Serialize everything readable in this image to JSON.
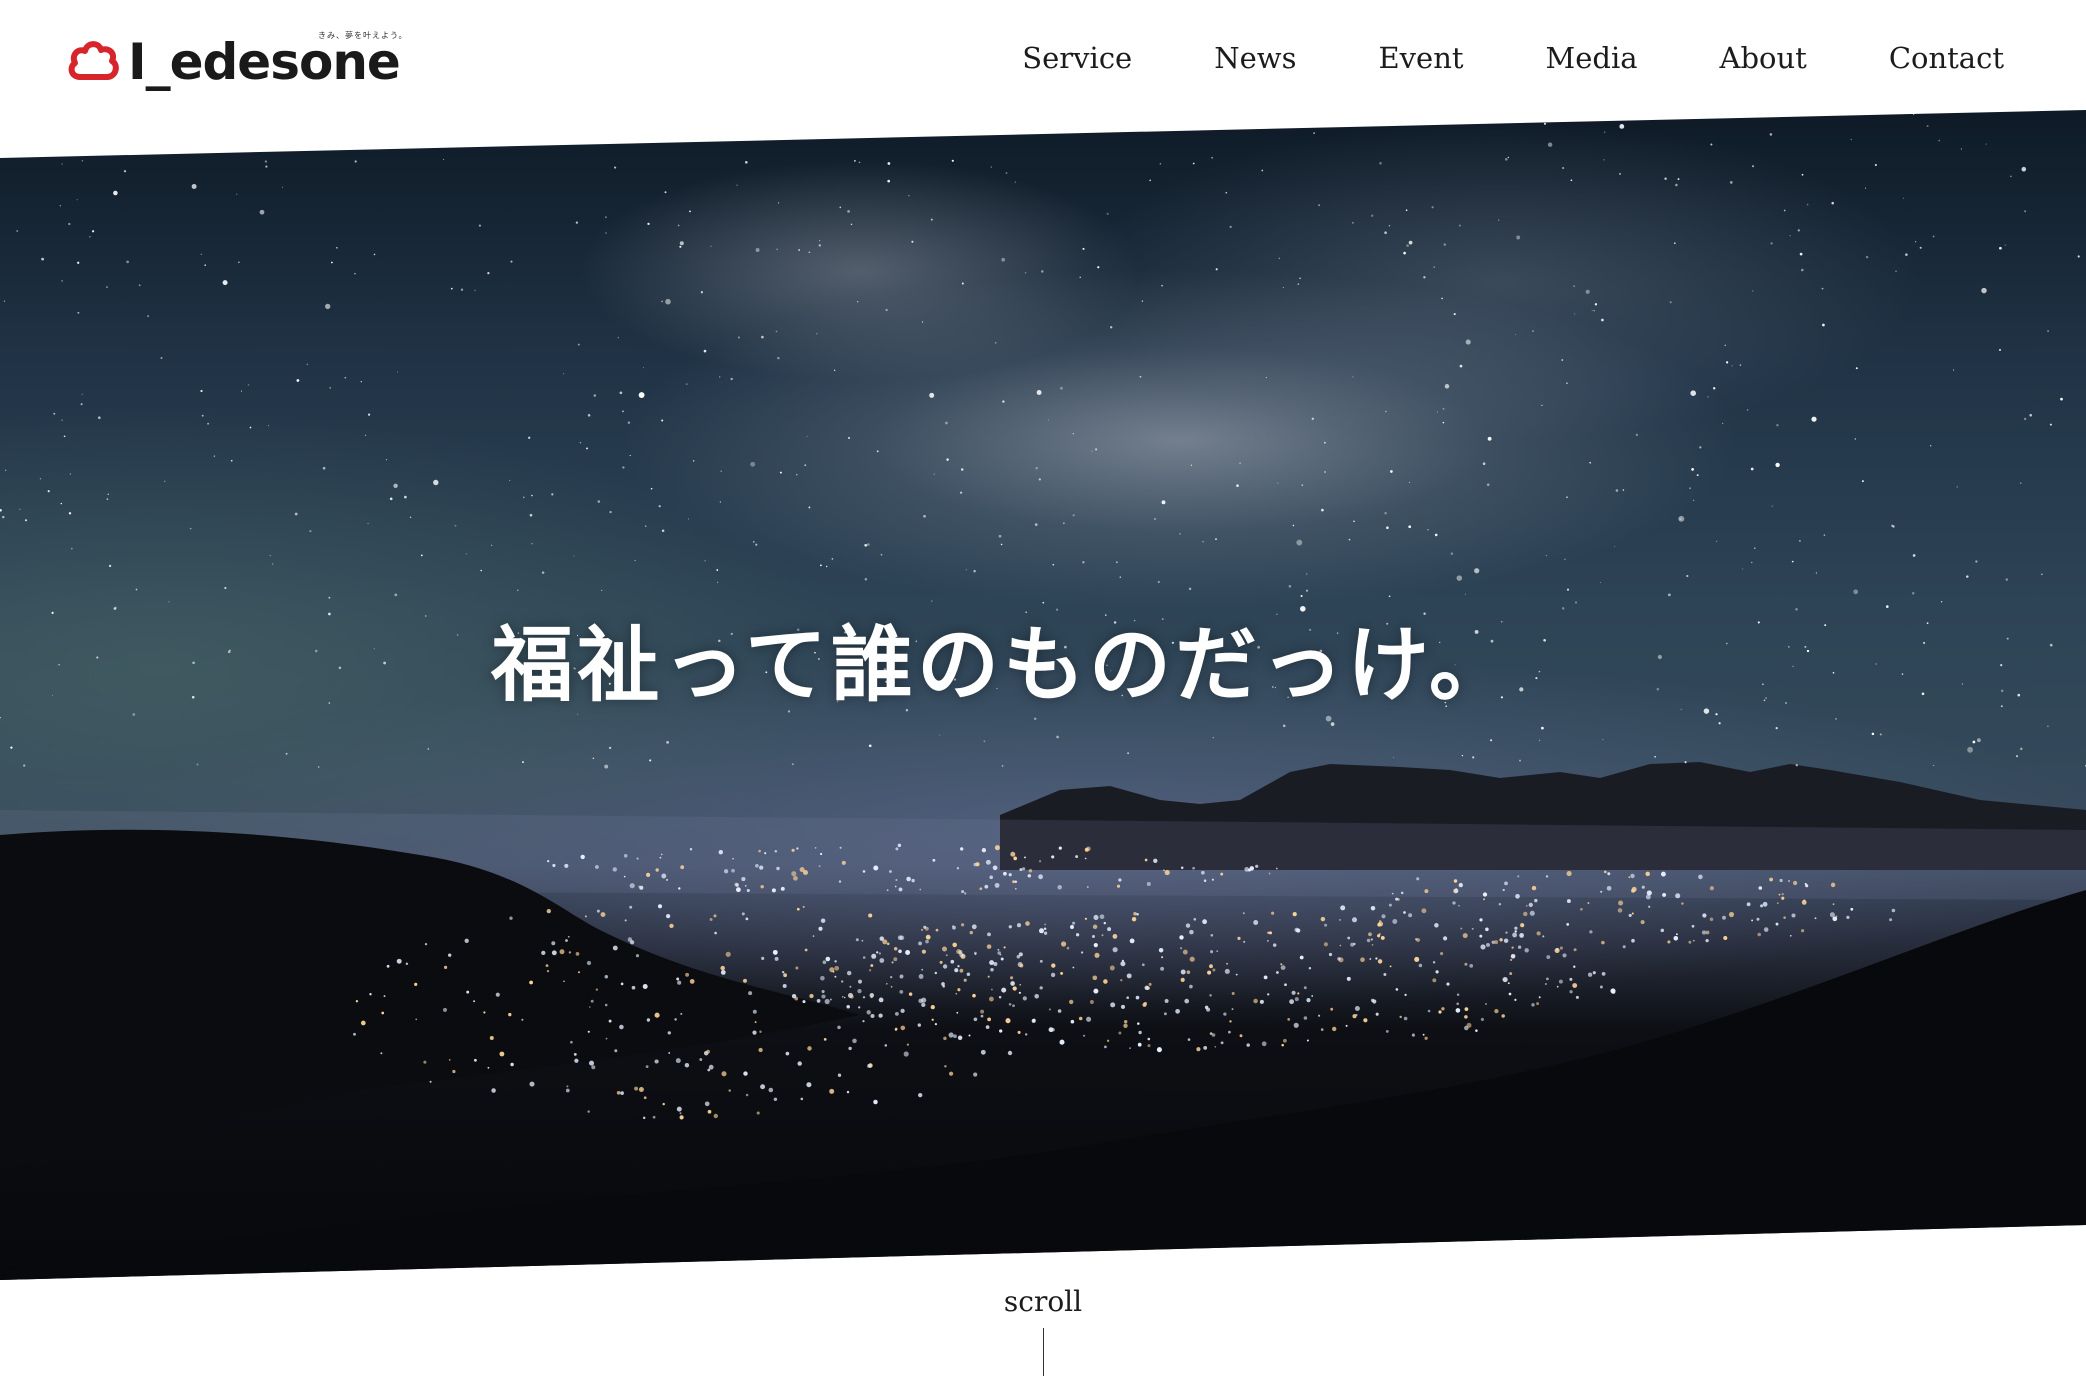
{
  "brand": {
    "name": "Ledesone",
    "wordmark": "I_edesone",
    "tagline": "きみ、夢を叶えよう。",
    "accent_color": "#d8242b",
    "logo_icon": "cloud-icon"
  },
  "nav": {
    "items": [
      {
        "label": "Service"
      },
      {
        "label": "News"
      },
      {
        "label": "Event"
      },
      {
        "label": "Media"
      },
      {
        "label": "About"
      },
      {
        "label": "Contact"
      }
    ]
  },
  "hero": {
    "title": "福祉って誰のものだっけ。",
    "background": "night-sky-milky-way-over-city-lights"
  },
  "scroll": {
    "label": "scroll"
  }
}
